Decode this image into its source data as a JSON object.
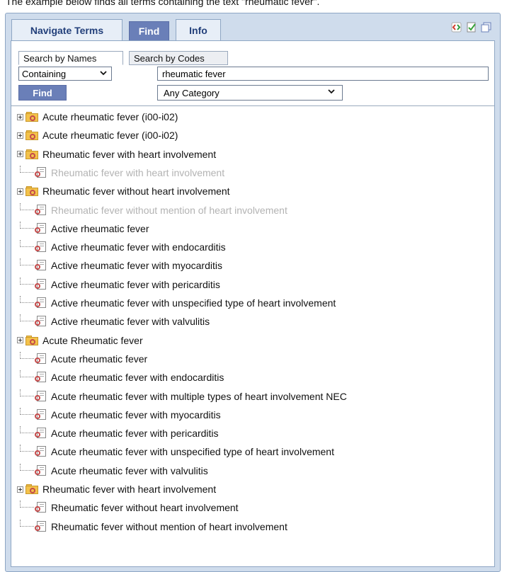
{
  "caption": "The example below finds all terms containing the text \"rheumatic fever\".",
  "tabs": {
    "navigate": "Navigate Terms",
    "find": "Find",
    "info": "Info"
  },
  "search_tabs": {
    "names": "Search by Names",
    "codes": "Search by Codes"
  },
  "search": {
    "mode": "Containing",
    "query": "rheumatic fever",
    "button": "Find",
    "category": "Any Category"
  },
  "colors": {
    "accent": "#6a7fb8",
    "panel": "#cfdcec",
    "dim_text": "#b3b3b3"
  },
  "tree": [
    {
      "label": "Acute rheumatic fever (i00-i02)",
      "type": "folder",
      "dim": false
    },
    {
      "label": "Acute rheumatic fever (i00-i02)",
      "type": "folder",
      "dim": false
    },
    {
      "label": "Rheumatic fever with heart involvement",
      "type": "folder",
      "dim": false
    },
    {
      "label": "Rheumatic fever with heart involvement",
      "type": "doc",
      "dim": true
    },
    {
      "label": "Rheumatic fever without heart involvement",
      "type": "folder",
      "dim": false
    },
    {
      "label": "Rheumatic fever without mention of heart involvement",
      "type": "doc",
      "dim": true
    },
    {
      "label": "Active rheumatic fever",
      "type": "doc",
      "dim": false
    },
    {
      "label": "Active rheumatic fever with endocarditis",
      "type": "doc",
      "dim": false
    },
    {
      "label": "Active rheumatic fever with myocarditis",
      "type": "doc",
      "dim": false
    },
    {
      "label": "Active rheumatic fever with pericarditis",
      "type": "doc",
      "dim": false
    },
    {
      "label": "Active rheumatic fever with unspecified type of heart involvement",
      "type": "doc",
      "dim": false
    },
    {
      "label": "Active rheumatic fever with valvulitis",
      "type": "doc",
      "dim": false
    },
    {
      "label": "Acute Rheumatic fever",
      "type": "folder",
      "dim": false
    },
    {
      "label": "Acute rheumatic fever",
      "type": "doc",
      "dim": false
    },
    {
      "label": "Acute rheumatic fever with endocarditis",
      "type": "doc",
      "dim": false
    },
    {
      "label": "Acute rheumatic fever with multiple types of heart involvement NEC",
      "type": "doc",
      "dim": false
    },
    {
      "label": "Acute rheumatic fever with myocarditis",
      "type": "doc",
      "dim": false
    },
    {
      "label": "Acute rheumatic fever with pericarditis",
      "type": "doc",
      "dim": false
    },
    {
      "label": "Acute rheumatic fever with unspecified type of heart involvement",
      "type": "doc",
      "dim": false
    },
    {
      "label": "Acute rheumatic fever with valvulitis",
      "type": "doc",
      "dim": false
    },
    {
      "label": "Rheumatic fever with heart involvement",
      "type": "folder",
      "dim": false
    },
    {
      "label": "Rheumatic fever without heart involvement",
      "type": "doc",
      "dim": false
    },
    {
      "label": "Rheumatic fever without mention of heart involvement",
      "type": "doc",
      "dim": false
    }
  ]
}
